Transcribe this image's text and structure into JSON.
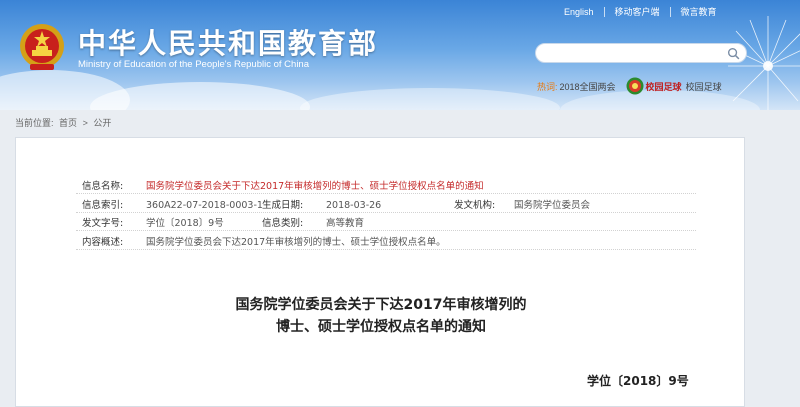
{
  "header": {
    "title": "中华人民共和国教育部",
    "subtitle": "Ministry of Education of the People's Republic of China",
    "links": [
      "English",
      "移动客户端",
      "微言教育"
    ],
    "search_placeholder": "",
    "hot_label": "热词:",
    "hot_item": "2018全国两会",
    "campus_football": "校园足球",
    "campus_football_2": "校园足球"
  },
  "breadcrumb": {
    "label": "当前位置:",
    "items": [
      "首页",
      "公开"
    ],
    "separator": ">"
  },
  "info": {
    "name_label": "信息名称:",
    "name_value": "国务院学位委员会关于下达2017年审核增列的博士、硕士学位授权点名单的通知",
    "index_label": "信息索引:",
    "index_value": "360A22-07-2018-0003-1",
    "date_label": "生成日期:",
    "date_value": "2018-03-26",
    "issuer_label": "发文机构:",
    "issuer_value": "国务院学位委员会",
    "doc_label": "发文字号:",
    "doc_value": "学位〔2018〕9号",
    "category_label": "信息类别:",
    "category_value": "高等教育",
    "summary_label": "内容概述:",
    "summary_value": "国务院学位委员会下达2017年审核增列的博士、硕士学位授权点名单。"
  },
  "article": {
    "title_line1": "国务院学位委员会关于下达2017年审核增列的",
    "title_line2": "博士、硕士学位授权点名单的通知",
    "doc_number": "学位〔2018〕9号"
  },
  "colors": {
    "header_blue": "#3b84d6",
    "title_red": "#c42a2a",
    "hot_orange": "#e67a12"
  },
  "icons": [
    "national-emblem-icon",
    "search-icon",
    "football-badge-icon",
    "dandelion-decoration"
  ]
}
